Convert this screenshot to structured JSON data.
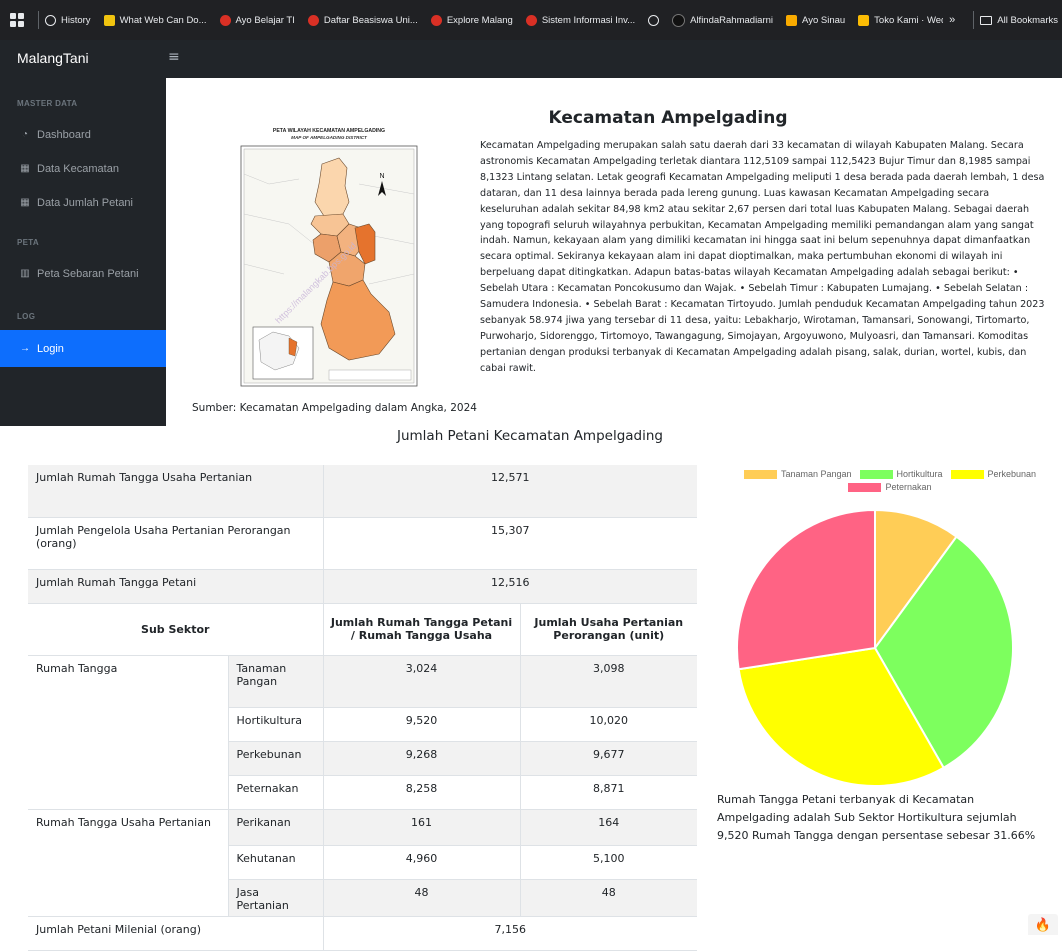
{
  "bookmarks": {
    "items": [
      {
        "label": "History",
        "icon": "history-icon",
        "color": "#e8eaed"
      },
      {
        "label": "What Web Can Do...",
        "icon": "page-icon",
        "color": "#f1c40f"
      },
      {
        "label": "Ayo Belajar TI",
        "icon": "red-dot-icon",
        "color": "#d93025"
      },
      {
        "label": "Daftar Beasiswa Uni...",
        "icon": "red-dot-icon",
        "color": "#d93025"
      },
      {
        "label": "Explore Malang",
        "icon": "red-dot-icon",
        "color": "#d93025"
      },
      {
        "label": "Sistem Informasi Inv...",
        "icon": "red-dot-icon",
        "color": "#d93025"
      },
      {
        "label": "",
        "icon": "globe-icon",
        "color": "#e8eaed"
      },
      {
        "label": "AlfindaRahmadiarni",
        "icon": "github-icon",
        "color": "#333333"
      },
      {
        "label": "Ayo Sinau",
        "icon": "book-icon",
        "color": "#f9ab00"
      },
      {
        "label": "Toko Kami · Weddi...",
        "icon": "shop-icon",
        "color": "#fbbc04"
      }
    ],
    "more": "»",
    "all_bookmarks": "All Bookmarks"
  },
  "navbar": {
    "brand": "MalangTani",
    "toggle": "≡"
  },
  "sidebar": {
    "heading_master": "MASTER DATA",
    "heading_peta": "PETA",
    "heading_log": "LOG",
    "items": [
      {
        "label": "Dashboard",
        "icon": "dashboard-icon"
      },
      {
        "label": "Data Kecamatan",
        "icon": "table-icon"
      },
      {
        "label": "Data Jumlah Petani",
        "icon": "table-icon"
      },
      {
        "label": "Peta Sebaran Petani",
        "icon": "map-icon"
      },
      {
        "label": "Login",
        "icon": "arrow-right-icon"
      }
    ],
    "icons": {
      "dashboard": "◔",
      "table": "▦",
      "map": "▥",
      "arrow": "→"
    }
  },
  "intro": {
    "title": "Kecamatan Ampelgading",
    "map_title": "PETA WILAYAH KECAMATAN AMPELGADING",
    "map_subtitle": "MAP OF AMPELGADING DISTRICT",
    "map_watermark": "https://malangkab.bps.go.id",
    "north": "N",
    "caption": "Sumber: Kecamatan Ampelgading dalam Angka, 2024",
    "text": "Kecamatan Ampelgading merupakan salah satu daerah dari 33 kecamatan di wilayah Kabupaten Malang. Secara astronomis Kecamatan Ampelgading terletak diantara 112,5109 sampai 112,5423 Bujur Timur dan 8,1985 sampai 8,1323 Lintang selatan. Letak geografi Kecamatan Ampelgading meliputi 1 desa berada pada daerah lembah, 1 desa dataran, dan 11 desa lainnya berada pada lereng gunung. Luas kawasan Kecamatan Ampelgading secara keseluruhan adalah sekitar 84,98 km2 atau sekitar 2,67 persen dari total luas Kabupaten Malang. Sebagai daerah yang topografi seluruh wilayahnya perbukitan, Kecamatan Ampelgading memiliki pemandangan alam yang sangat indah. Namun, kekayaan alam yang dimiliki kecamatan ini hingga saat ini belum sepenuhnya dapat dimanfaatkan secara optimal. Sekiranya kekayaan alam ini dapat dioptimalkan, maka pertumbuhan ekonomi di wilayah ini berpeluang dapat ditingkatkan. Adapun batas-batas wilayah Kecamatan Ampelgading adalah sebagai berikut: • Sebelah Utara : Kecamatan Poncokusumo dan Wajak. • Sebelah Timur : Kabupaten Lumajang. • Sebelah Selatan : Samudera Indonesia. • Sebelah Barat : Kecamatan Tirtoyudo. Jumlah penduduk Kecamatan Ampelgading tahun 2023 sebanyak 58.974 jiwa yang tersebar di 11 desa, yaitu: Lebakharjo, Wirotaman, Tamansari, Sonowangi, Tirtomarto, Purwoharjo, Sidorenggo, Tirtomoyo, Tawangagung, Simojayan, Argoyuwono, Mulyoasri, dan Tamansari. Komoditas pertanian dengan produksi terbanyak di Kecamatan Ampelgading adalah pisang, salak, durian, wortel, kubis, dan cabai rawit."
  },
  "section_title": "Jumlah Petani Kecamatan Ampelgading",
  "table": {
    "summary": [
      {
        "label": "Jumlah Rumah Tangga Usaha Pertanian",
        "value": "12,571"
      },
      {
        "label": "Jumlah Pengelola Usaha Pertanian Perorangan (orang)",
        "value": "15,307"
      },
      {
        "label": "Jumlah Rumah Tangga Petani",
        "value": "12,516"
      }
    ],
    "headers": {
      "sub_sektor": "Sub Sektor",
      "rtp": "Jumlah Rumah Tangga Petani / Rumah Tangga Usaha",
      "usaha": "Jumlah Usaha Pertanian Perorangan (unit)"
    },
    "group_rumah_tangga": "Rumah Tangga",
    "group_rtup": "Rumah Tangga Usaha Pertanian",
    "rows": [
      {
        "sub": "Tanaman Pangan",
        "rtp": "3,024",
        "usaha": "3,098"
      },
      {
        "sub": "Hortikultura",
        "rtp": "9,520",
        "usaha": "10,020"
      },
      {
        "sub": "Perkebunan",
        "rtp": "9,268",
        "usaha": "9,677"
      },
      {
        "sub": "Peternakan",
        "rtp": "8,258",
        "usaha": "8,871"
      },
      {
        "sub": "Perikanan",
        "rtp": "161",
        "usaha": "164"
      },
      {
        "sub": "Kehutanan",
        "rtp": "4,960",
        "usaha": "5,100"
      },
      {
        "sub": "Jasa Pertanian",
        "rtp": "48",
        "usaha": "48"
      }
    ],
    "milenial": {
      "label": "Jumlah Petani Milenial (orang)",
      "value": "7,156"
    }
  },
  "chart_data": {
    "type": "pie",
    "categories": [
      "Tanaman Pangan",
      "Hortikultura",
      "Perkebunan",
      "Peternakan"
    ],
    "values": [
      3024,
      9520,
      9268,
      8258
    ],
    "colors": [
      "#ffcd56",
      "#7dff5e",
      "#ffff00",
      "#ff6384"
    ],
    "legend_position": "top"
  },
  "pie_note": "Rumah Tangga Petani terbanyak di Kecamatan Ampelgading adalah Sub Sektor Hortikultura sejumlah 9,520 Rumah Tangga dengan persentase sebesar 31.66%",
  "fire_icon": "🔥"
}
